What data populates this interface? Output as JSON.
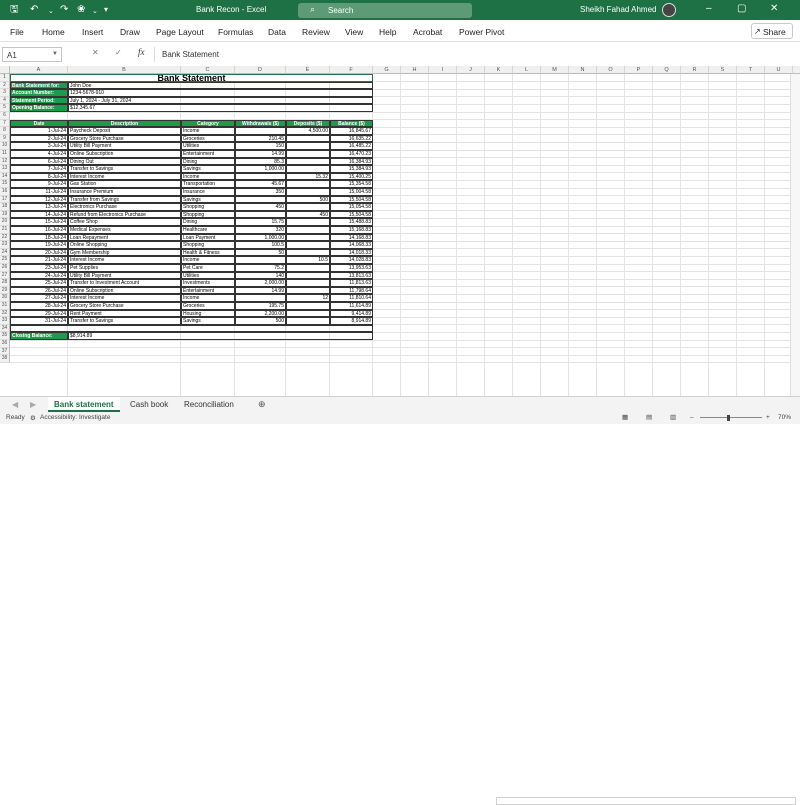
{
  "titlebar": {
    "title": "Bank Recon  -  Excel",
    "search_placeholder": "Search",
    "user_name": "Sheikh Fahad Ahmed",
    "icons": [
      "save-icon",
      "undo-icon",
      "redo-icon",
      "autosave-icon",
      "customize-icon"
    ]
  },
  "menu": {
    "items": [
      "File",
      "Home",
      "Insert",
      "Draw",
      "Page Layout",
      "Formulas",
      "Data",
      "Review",
      "View",
      "Help",
      "Acrobat",
      "Power Pivot"
    ],
    "share": "Share"
  },
  "formula_bar": {
    "name_box": "A1",
    "fx": "fx",
    "value": "Bank Statement"
  },
  "columns": [
    "A",
    "B",
    "C",
    "D",
    "E",
    "F",
    "G",
    "H",
    "I",
    "J",
    "K",
    "L",
    "M",
    "N",
    "O",
    "P",
    "Q",
    "R",
    "S",
    "T",
    "U",
    "V",
    "W"
  ],
  "rows": [
    "1",
    "2",
    "3",
    "4",
    "5",
    "6",
    "7",
    "8",
    "9",
    "10",
    "11",
    "12",
    "13",
    "14",
    "15",
    "16",
    "17",
    "18",
    "19",
    "20",
    "21",
    "22",
    "23",
    "24",
    "25",
    "26",
    "27",
    "28",
    "29",
    "30",
    "31",
    "32",
    "33",
    "34",
    "35",
    "36",
    "37",
    "38"
  ],
  "sheet": {
    "title": "Bank Statement",
    "info": [
      {
        "label": "Bank Statement for:",
        "value": "John Doe"
      },
      {
        "label": "Account Number:",
        "value": "1234-5678-910"
      },
      {
        "label": "Statement Period:",
        "value": "July 1, 2024 - July 31, 2024"
      },
      {
        "label": "Opening Balance:",
        "value": "$12,345.67"
      }
    ],
    "headers": [
      "Date",
      "Description",
      "Category",
      "Withdrawals ($)",
      "Deposits ($)",
      "Balance ($)"
    ],
    "transactions": [
      [
        "1-Jul-24",
        "Paycheck Deposit",
        "Income",
        "",
        "4,500.00",
        "16,845.67"
      ],
      [
        "2-Jul-24",
        "Grocery Store Purchase",
        "Groceries",
        "210.45",
        "",
        "16,635.22"
      ],
      [
        "3-Jul-24",
        "Utility Bill Payment",
        "Utilities",
        "150",
        "",
        "16,485.22"
      ],
      [
        "4-Jul-24",
        "Online Subscription",
        "Entertainment",
        "14.99",
        "",
        "16,470.23"
      ],
      [
        "6-Jul-24",
        "Dining Out",
        "Dining",
        "85.3",
        "",
        "16,384.93"
      ],
      [
        "7-Jul-24",
        "Transfer to Savings",
        "Savings",
        "1,000.00",
        "",
        "15,384.93"
      ],
      [
        "8-Jul-24",
        "Interest Income",
        "Income",
        "",
        "15.32",
        "15,400.25"
      ],
      [
        "9-Jul-24",
        "Gas Station",
        "Transportation",
        "45.67",
        "",
        "15,354.58"
      ],
      [
        "11-Jul-24",
        "Insurance Premium",
        "Insurance",
        "350",
        "",
        "15,004.58"
      ],
      [
        "12-Jul-24",
        "Transfer from Savings",
        "Savings",
        "",
        "500",
        "15,504.58"
      ],
      [
        "13-Jul-24",
        "Electronics Purchase",
        "Shopping",
        "450",
        "",
        "15,054.58"
      ],
      [
        "14-Jul-24",
        "Refund from Electronics Purchase",
        "Shopping",
        "",
        "450",
        "15,504.58"
      ],
      [
        "15-Jul-24",
        "Coffee Shop",
        "Dining",
        "15.75",
        "",
        "15,488.83"
      ],
      [
        "16-Jul-24",
        "Medical Expenses",
        "Healthcare",
        "320",
        "",
        "15,168.83"
      ],
      [
        "18-Jul-24",
        "Loan Repayment",
        "Loan Payment",
        "1,000.00",
        "",
        "14,168.83"
      ],
      [
        "19-Jul-24",
        "Online Shopping",
        "Shopping",
        "100.5",
        "",
        "14,068.33"
      ],
      [
        "20-Jul-24",
        "Gym Membership",
        "Health & Fitness",
        "50",
        "",
        "14,018.33"
      ],
      [
        "21-Jul-24",
        "Interest Income",
        "Income",
        "",
        "10.5",
        "14,028.83"
      ],
      [
        "23-Jul-24",
        "Pet Supplies",
        "Pet Care",
        "75.2",
        "",
        "13,953.63"
      ],
      [
        "24-Jul-24",
        "Utility Bill Payment",
        "Utilities",
        "140",
        "",
        "13,813.63"
      ],
      [
        "25-Jul-24",
        "Transfer to Investment Account",
        "Investments",
        "2,000.00",
        "",
        "11,813.63"
      ],
      [
        "26-Jul-24",
        "Online Subscription",
        "Entertainment",
        "14.99",
        "",
        "11,798.64"
      ],
      [
        "27-Jul-24",
        "Interest Income",
        "Income",
        "",
        "12",
        "11,810.64"
      ],
      [
        "28-Jul-24",
        "Grocery Store Purchase",
        "Groceries",
        "195.75",
        "",
        "11,614.89"
      ],
      [
        "29-Jul-24",
        "Rent Payment",
        "Housing",
        "2,200.00",
        "",
        "9,414.89"
      ],
      [
        "31-Jul-24",
        "Transfer to Savings",
        "Savings",
        "500",
        "",
        "8,914.89"
      ]
    ],
    "closing_label": "Closing Balance:",
    "closing_value": "$8,914.89"
  },
  "tabs": [
    "Bank statement",
    "Cash book",
    "Reconciliation"
  ],
  "status": {
    "ready": "Ready",
    "accessibility": "Accessibility: Investigate",
    "zoom": "70%"
  },
  "colors": {
    "excel_green": "#1e7145",
    "header_green": "#1f9a4d"
  }
}
